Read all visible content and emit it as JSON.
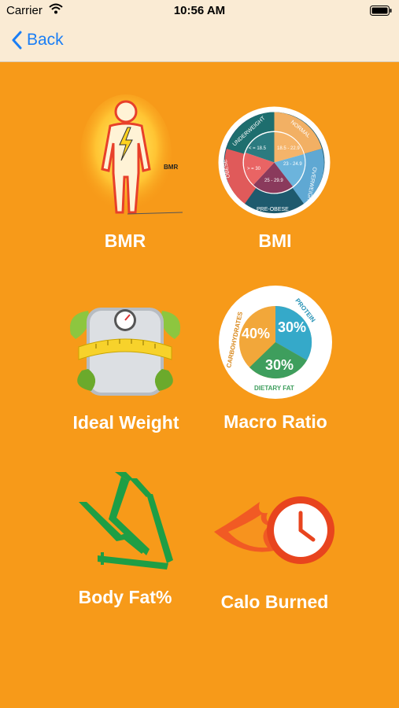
{
  "status_bar": {
    "carrier": "Carrier",
    "time": "10:56 AM"
  },
  "nav": {
    "back_label": "Back"
  },
  "colors": {
    "background": "#F79A19",
    "bar": "#FAEBD4",
    "accent": "#1A7EF5"
  },
  "tiles": [
    {
      "label": "BMR",
      "icon": "body-energy-icon",
      "icon_text": "BMR"
    },
    {
      "label": "BMI",
      "icon": "bmi-wheel-icon",
      "icon_text": [
        "UNDERWEIGHT",
        "NORMAL",
        "OVERWEIGHT",
        "PRE-OBESE",
        "OBESE",
        "< = 18.5",
        "18.5 - 22.9",
        "23 - 24.9",
        "25 - 29.9",
        "> = 30"
      ]
    },
    {
      "label": "Ideal Weight",
      "icon": "scale-icon"
    },
    {
      "label": "Macro Ratio",
      "icon": "macro-pie-icon",
      "icon_text": [
        "CARBOHYDRATES",
        "PROTEIN",
        "DIETARY FAT",
        "40%",
        "30%",
        "30%"
      ]
    },
    {
      "label": "Body Fat%",
      "icon": "caliper-icon"
    },
    {
      "label": "Calo Burned",
      "icon": "fire-clock-icon"
    }
  ]
}
